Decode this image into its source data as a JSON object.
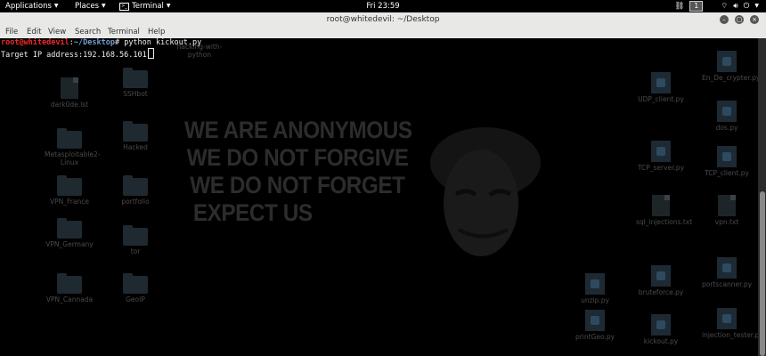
{
  "panel": {
    "applications": "Applications",
    "places": "Places",
    "terminal": "Terminal",
    "clock": "Fri 23:59",
    "workspace": "1"
  },
  "window": {
    "title": "root@whitedevil: ~/Desktop",
    "menu": [
      "File",
      "Edit",
      "View",
      "Search",
      "Terminal",
      "Help"
    ]
  },
  "terminal": {
    "user_host": "root@whitedevil",
    "sep": ":",
    "path": "~/Desktop",
    "prompt_char": "#",
    "command": " python kickout.py",
    "output": "Target IP address:192.168.56.101"
  },
  "wallpaper": {
    "lines": [
      "WE ARE ANONYMOUS",
      "WE DO NOT FORGIVE",
      "WE DO NOT FORGET",
      "EXPECT US"
    ]
  },
  "desktop_icons": [
    {
      "label": "hacking-with-python",
      "kind": "folder"
    },
    {
      "label": "dark0de.lst",
      "kind": "file"
    },
    {
      "label": "SSHbot",
      "kind": "folder"
    },
    {
      "label": "Metasploitable2-Linux",
      "kind": "folder"
    },
    {
      "label": "Hacked",
      "kind": "folder"
    },
    {
      "label": "VPN_France",
      "kind": "folder"
    },
    {
      "label": "portfolio",
      "kind": "folder"
    },
    {
      "label": "VPN_Germany",
      "kind": "folder"
    },
    {
      "label": "tor",
      "kind": "folder"
    },
    {
      "label": "VPN_Cannada",
      "kind": "folder"
    },
    {
      "label": "GeoIP",
      "kind": "folder"
    },
    {
      "label": "En_De_crypter.py",
      "kind": "py"
    },
    {
      "label": "UDP_client.py",
      "kind": "py"
    },
    {
      "label": "dos.py",
      "kind": "py"
    },
    {
      "label": "TCP_server.py",
      "kind": "py"
    },
    {
      "label": "TCP_client.py",
      "kind": "py"
    },
    {
      "label": "sql_injections.txt",
      "kind": "file"
    },
    {
      "label": "vpn.txt",
      "kind": "file"
    },
    {
      "label": "bruteforce.py",
      "kind": "py"
    },
    {
      "label": "portscanner.py",
      "kind": "py"
    },
    {
      "label": "unzip.py",
      "kind": "py"
    },
    {
      "label": "injection_tester.py",
      "kind": "py"
    },
    {
      "label": "printGeo.py",
      "kind": "py"
    },
    {
      "label": "kickout.py",
      "kind": "py"
    }
  ],
  "colors": {
    "prompt_user": "#ef2929",
    "prompt_path": "#729fcf",
    "chrome": "#e8e8e7"
  }
}
